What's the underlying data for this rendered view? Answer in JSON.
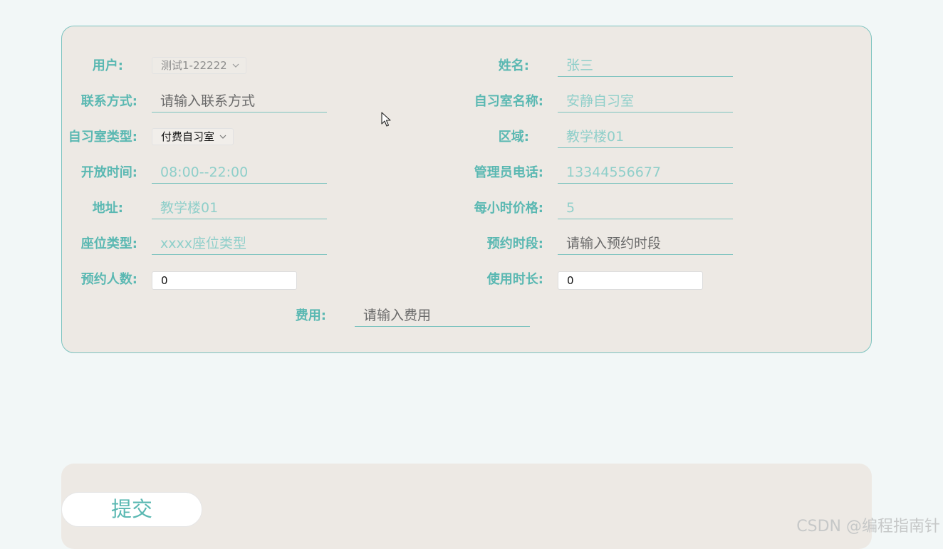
{
  "form": {
    "user": {
      "label": "用户:",
      "value": "测试1-22222"
    },
    "name": {
      "label": "姓名:",
      "value": "张三"
    },
    "contact": {
      "label": "联系方式:",
      "placeholder": "请输入联系方式"
    },
    "room_name": {
      "label": "自习室名称:",
      "value": "安静自习室"
    },
    "room_type": {
      "label": "自习室类型:",
      "value": "付费自习室"
    },
    "area": {
      "label": "区域:",
      "value": "教学楼01"
    },
    "open_time": {
      "label": "开放时间:",
      "value": "08:00--22:00"
    },
    "admin_phone": {
      "label": "管理员电话:",
      "value": "13344556677"
    },
    "address": {
      "label": "地址:",
      "value": "教学楼01"
    },
    "hourly_price": {
      "label": "每小时价格:",
      "value": "5"
    },
    "seat_type": {
      "label": "座位类型:",
      "value": "xxxx座位类型"
    },
    "booking_period": {
      "label": "预约时段:",
      "placeholder": "请输入预约时段"
    },
    "people_count": {
      "label": "预约人数:",
      "value": "0"
    },
    "usage_duration": {
      "label": "使用时长:",
      "value": "0"
    },
    "fee": {
      "label": "费用:",
      "placeholder": "请输入费用"
    }
  },
  "actions": {
    "submit_label": "提交"
  },
  "watermark": "CSDN @编程指南针",
  "icons": {
    "dropdown": "chevron-down-icon",
    "cursor": "mouse-cursor-icon"
  },
  "colors": {
    "accent": "#5ab8b2",
    "underline": "#7cc3bf",
    "card_background": "#ede9e4",
    "page_background": "#f2f7f7"
  }
}
